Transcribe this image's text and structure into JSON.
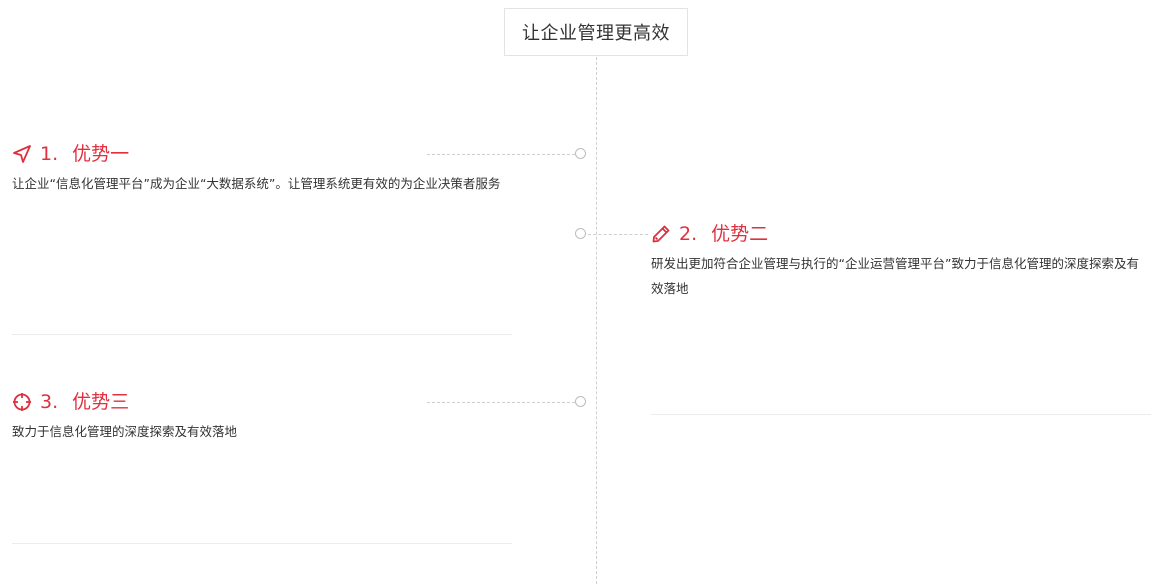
{
  "header": {
    "title": "让企业管理更高效"
  },
  "items": [
    {
      "number": "1.",
      "title": "优势一",
      "icon": "send-icon",
      "description": "让企业“信息化管理平台”成为企业“大数据系统”。让管理系统更有效的为企业决策者服务"
    },
    {
      "number": "2.",
      "title": "优势二",
      "icon": "pencil-icon",
      "description": "研发出更加符合企业管理与执行的“企业运营管理平台”致力于信息化管理的深度探索及有效落地"
    },
    {
      "number": "3.",
      "title": "优势三",
      "icon": "crosshair-icon",
      "description": "致力于信息化管理的深度探索及有效落地"
    }
  ],
  "colors": {
    "accent": "#e0303f",
    "text": "#333333",
    "line": "#cfcfcf"
  }
}
